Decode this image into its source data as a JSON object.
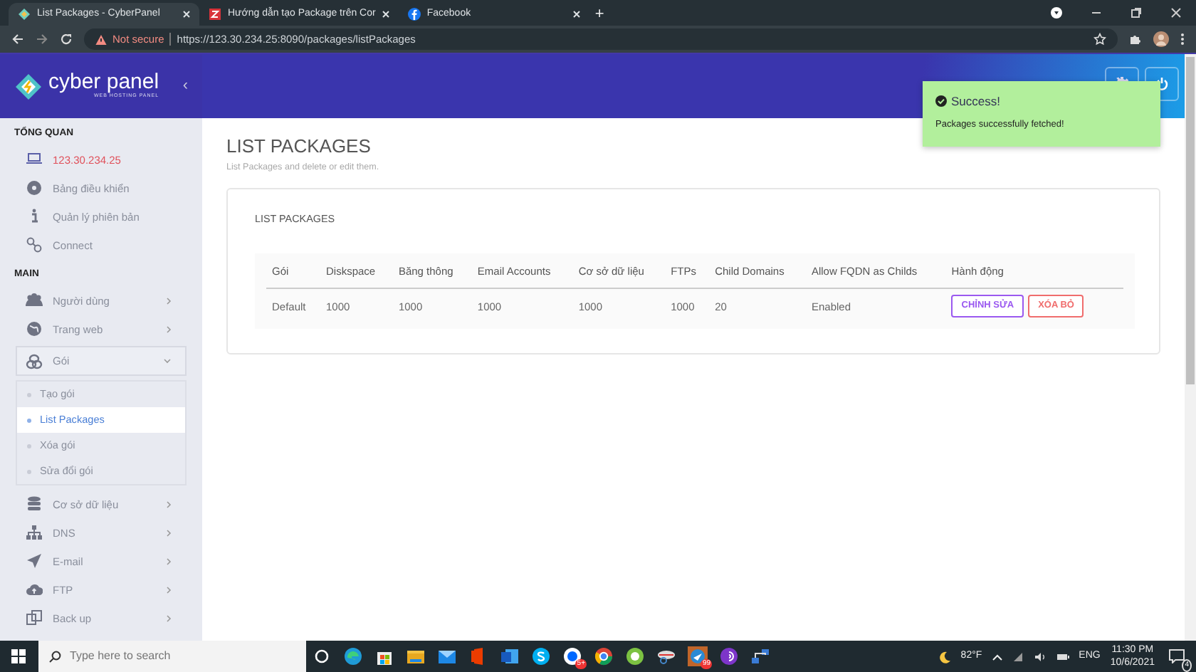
{
  "browser": {
    "tabs": [
      {
        "title": "List Packages - CyberPanel",
        "selected": true
      },
      {
        "title": "Hướng dẫn tạo Package trên Cor",
        "selected": false
      },
      {
        "title": "Facebook",
        "selected": false
      }
    ],
    "new_tab": "+",
    "security": "Not secure",
    "url": "https://123.30.234.25:8090/packages/listPackages"
  },
  "sidebar": {
    "brand": "cyber panel",
    "tagline": "WEB HOSTING PANEL",
    "collapse": "‹",
    "sections": [
      {
        "title": "TỔNG QUAN",
        "items": [
          {
            "label": "123.30.234.25",
            "kind": "ip"
          },
          {
            "label": "Bảng điều khiển",
            "kind": "link"
          },
          {
            "label": "Quản lý phiên bản",
            "kind": "link"
          },
          {
            "label": "Connect",
            "kind": "link"
          }
        ]
      },
      {
        "title": "MAIN",
        "items": [
          {
            "label": "Người dùng",
            "kind": "menu",
            "expanded": false
          },
          {
            "label": "Trang web",
            "kind": "menu",
            "expanded": false
          },
          {
            "label": "Gói",
            "kind": "menu",
            "expanded": true,
            "children": [
              {
                "label": "Tạo gói",
                "selected": false
              },
              {
                "label": "List Packages",
                "selected": true
              },
              {
                "label": "Xóa gói",
                "selected": false
              },
              {
                "label": "Sửa đổi gói",
                "selected": false
              }
            ]
          },
          {
            "label": "Cơ sở dữ liệu",
            "kind": "menu",
            "expanded": false
          },
          {
            "label": "DNS",
            "kind": "menu",
            "expanded": false
          },
          {
            "label": "E-mail",
            "kind": "menu",
            "expanded": false
          },
          {
            "label": "FTP",
            "kind": "menu",
            "expanded": false
          },
          {
            "label": "Back up",
            "kind": "menu",
            "expanded": false
          }
        ]
      }
    ]
  },
  "page": {
    "title": "LIST PACKAGES",
    "subtitle": "List Packages and delete or edit them.",
    "card_title": "LIST PACKAGES",
    "table": {
      "columns": [
        "Gói",
        "Diskspace",
        "Băng thông",
        "Email Accounts",
        "Cơ sở dữ liệu",
        "FTPs",
        "Child Domains",
        "Allow FQDN as Childs",
        "Hành động"
      ],
      "rows": [
        {
          "cells": [
            "Default",
            "1000",
            "1000",
            "1000",
            "1000",
            "1000",
            "20",
            "Enabled"
          ],
          "actions": [
            "CHỈNH SỬA",
            "XÓA BỎ"
          ]
        }
      ]
    }
  },
  "toast": {
    "title": "Success!",
    "message": "Packages successfully fetched!"
  },
  "taskbar": {
    "search_placeholder": "Type here to search",
    "badges": [
      "5+",
      "99"
    ],
    "weather": "82°F",
    "language": "ENG",
    "time": "11:30 PM",
    "date": "10/6/2021",
    "notifications": "4"
  }
}
